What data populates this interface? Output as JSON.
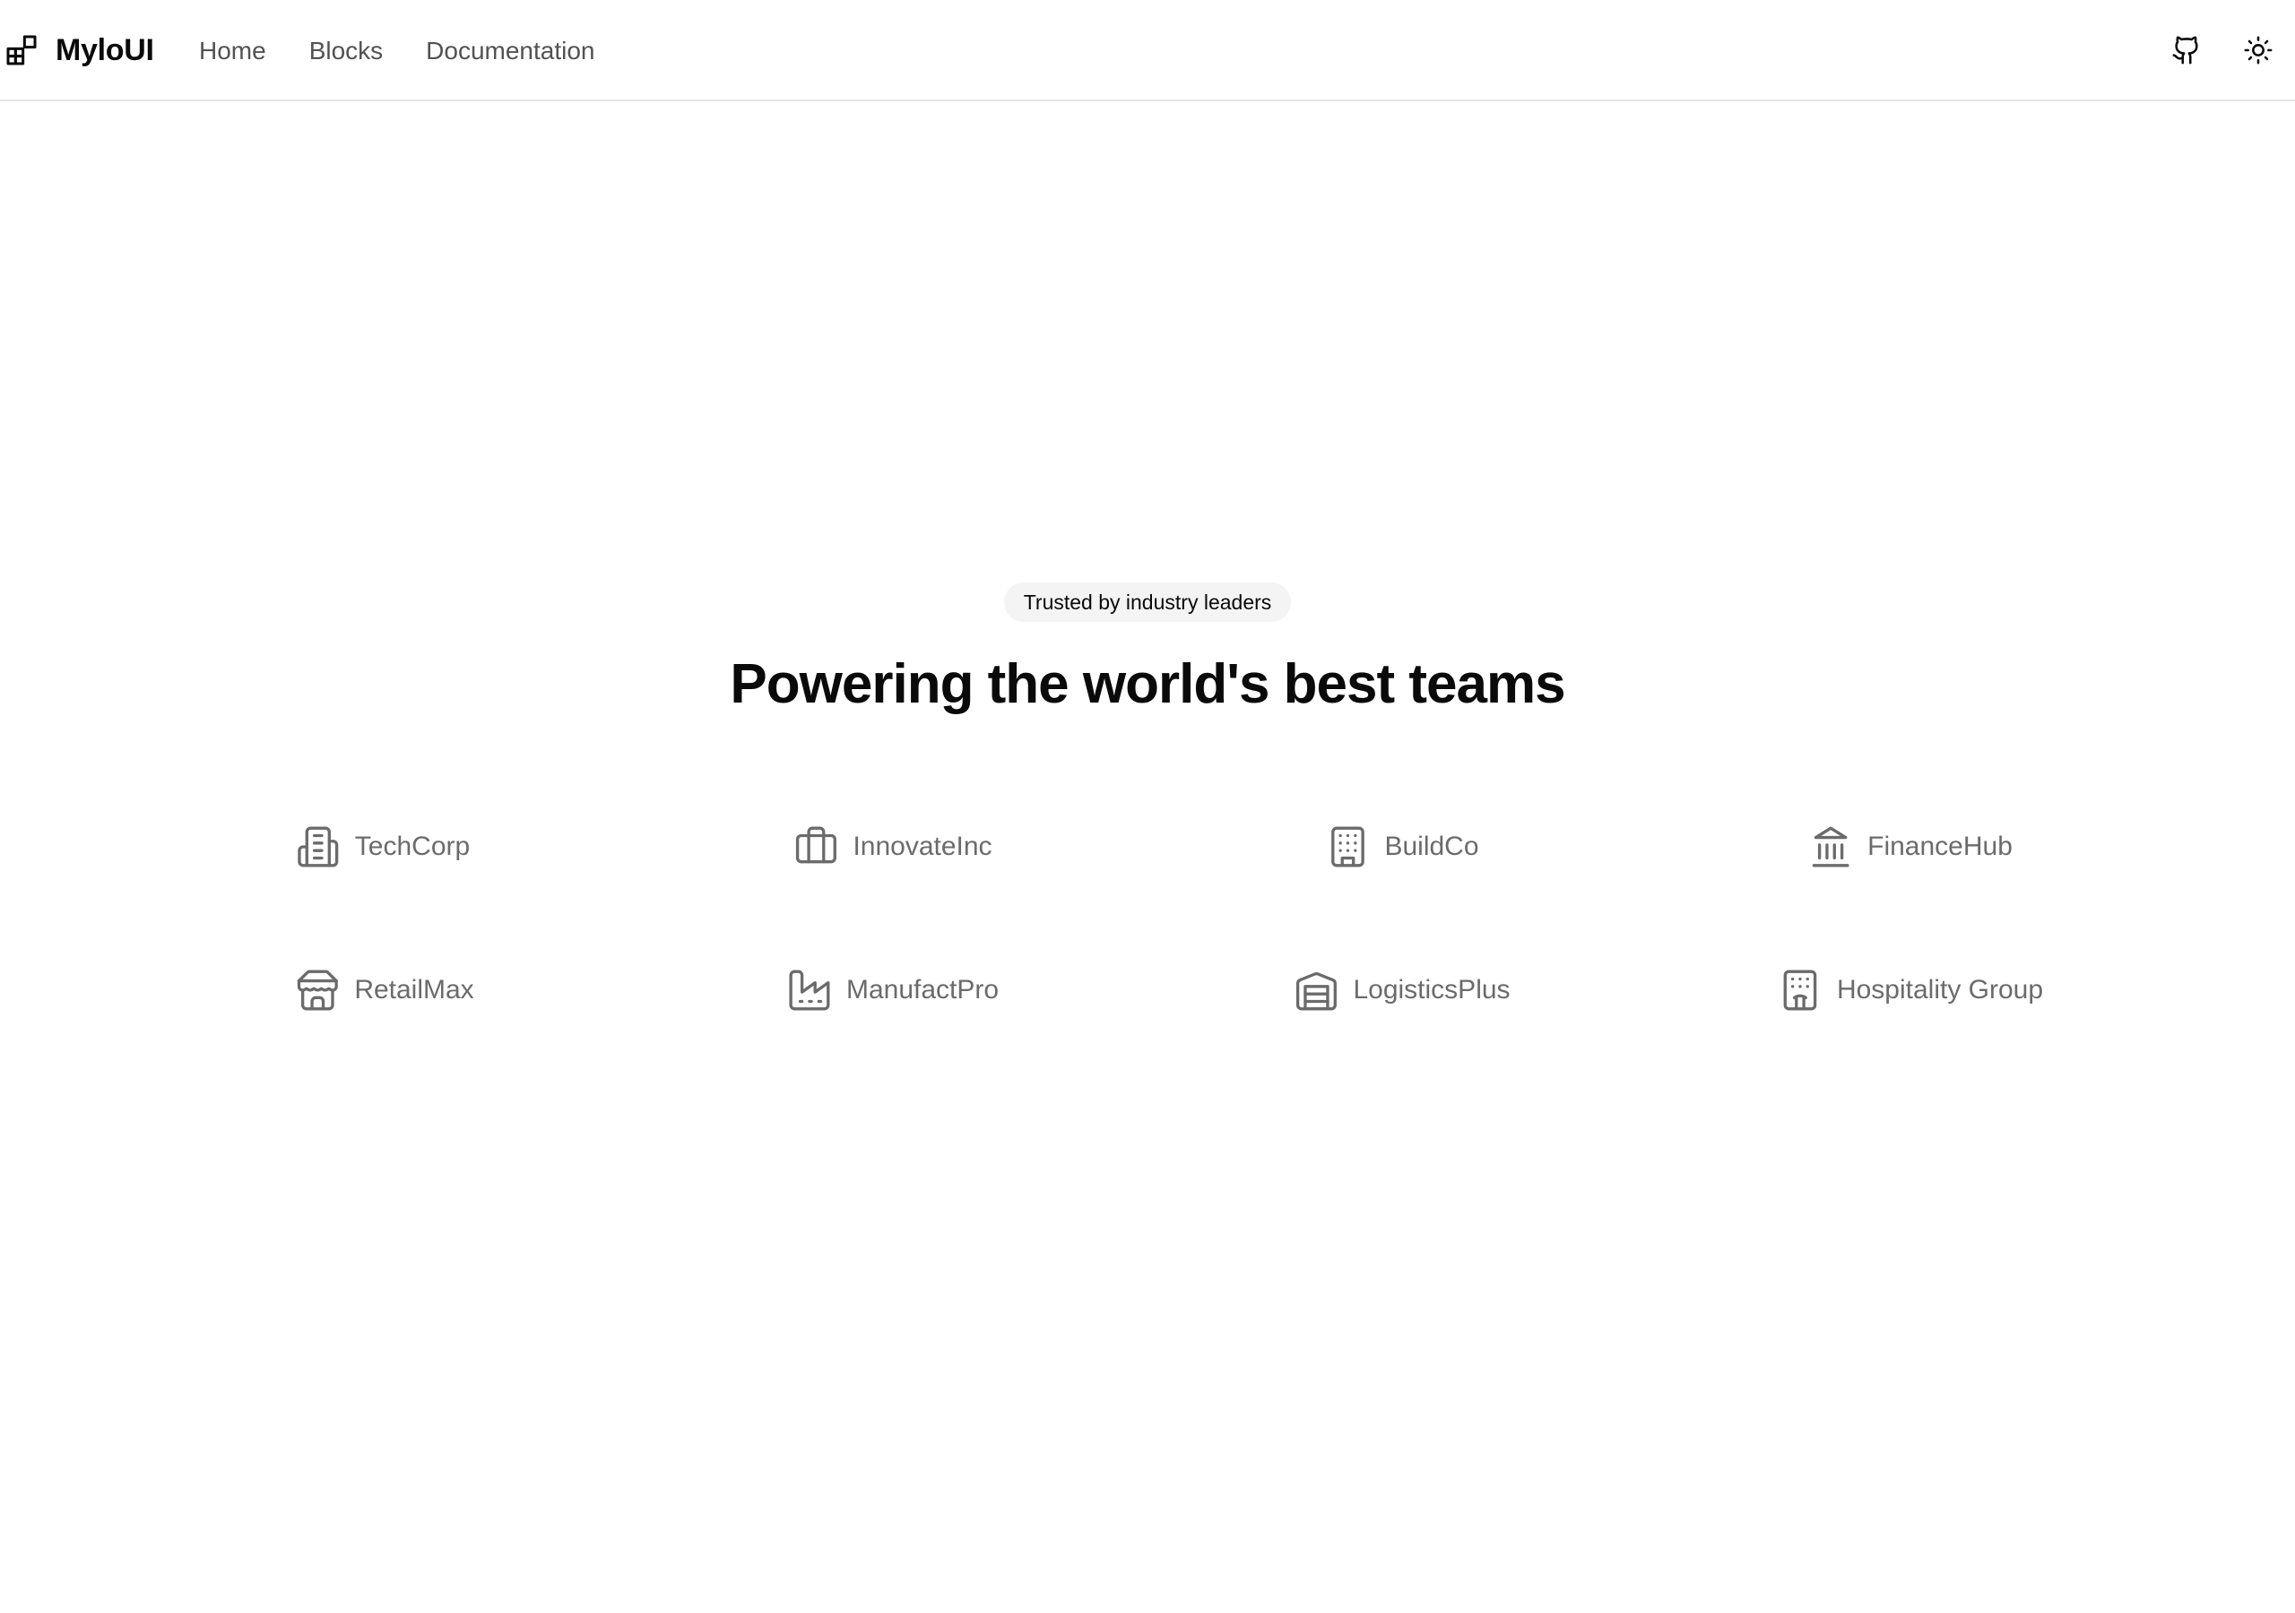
{
  "header": {
    "brand": "MyloUI",
    "nav": [
      "Home",
      "Blocks",
      "Documentation"
    ],
    "actions": {
      "github_icon": "github-icon",
      "theme_icon": "sun-icon"
    }
  },
  "hero": {
    "badge": "Trusted by industry leaders",
    "title": "Powering the world's best teams"
  },
  "logos": [
    {
      "name": "TechCorp",
      "icon": "building-icon"
    },
    {
      "name": "InnovateInc",
      "icon": "briefcase-icon"
    },
    {
      "name": "BuildCo",
      "icon": "office-building-icon"
    },
    {
      "name": "FinanceHub",
      "icon": "bank-icon"
    },
    {
      "name": "RetailMax",
      "icon": "store-icon"
    },
    {
      "name": "ManufactPro",
      "icon": "factory-icon"
    },
    {
      "name": "LogisticsPlus",
      "icon": "warehouse-icon"
    },
    {
      "name": "Hospitality Group",
      "icon": "hotel-icon"
    }
  ],
  "colors": {
    "text": "#0a0a0a",
    "muted": "#6b6b6b",
    "nav": "#525252",
    "badge_bg": "#f4f4f5",
    "border": "#e5e5e5"
  }
}
